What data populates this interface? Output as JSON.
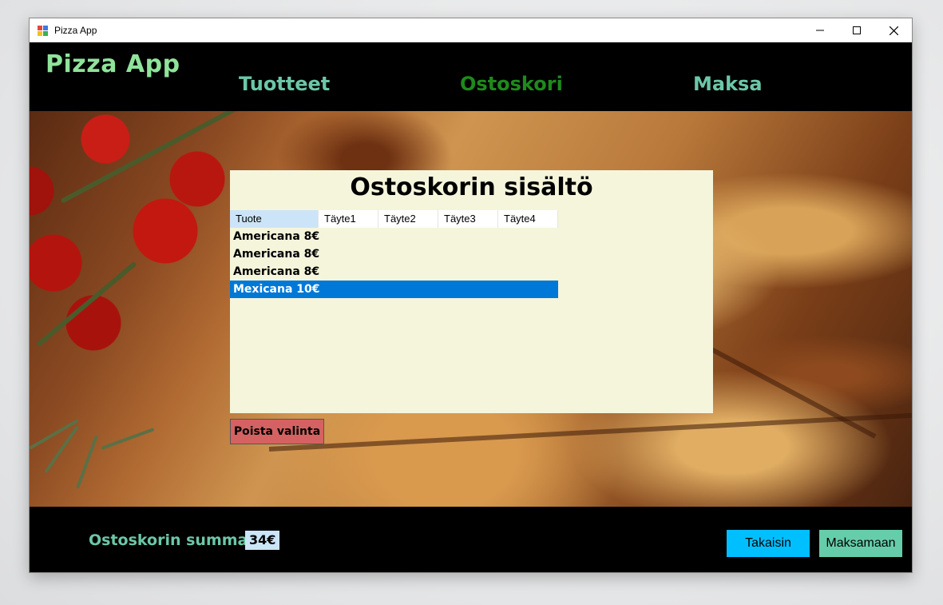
{
  "window": {
    "title": "Pizza App"
  },
  "header": {
    "brand": "Pizza App",
    "nav": [
      {
        "label": "Tuotteet"
      },
      {
        "label": "Ostoskori"
      },
      {
        "label": "Maksa"
      }
    ]
  },
  "cart": {
    "title": "Ostoskorin sisältö",
    "columns": [
      "Tuote",
      "Täyte1",
      "Täyte2",
      "Täyte3",
      "Täyte4"
    ],
    "rows": [
      {
        "product": "Americana 8€",
        "selected": false
      },
      {
        "product": "Americana 8€",
        "selected": false
      },
      {
        "product": "Americana 8€",
        "selected": false
      },
      {
        "product": "Mexicana 10€",
        "selected": true
      }
    ],
    "delete_label": "Poista valinta"
  },
  "footer": {
    "sum_label": "Ostoskorin summa:",
    "sum_value": "34€",
    "back_label": "Takaisin",
    "pay_label": "Maksamaan"
  },
  "colors": {
    "accent_green": "#6cc7a7",
    "brand_green": "#8fe39b",
    "active_nav": "#1e8a1c",
    "selection": "#0078d7",
    "delete_button": "#d46262",
    "back_button": "#00bfff",
    "pay_button": "#66cdaa"
  }
}
